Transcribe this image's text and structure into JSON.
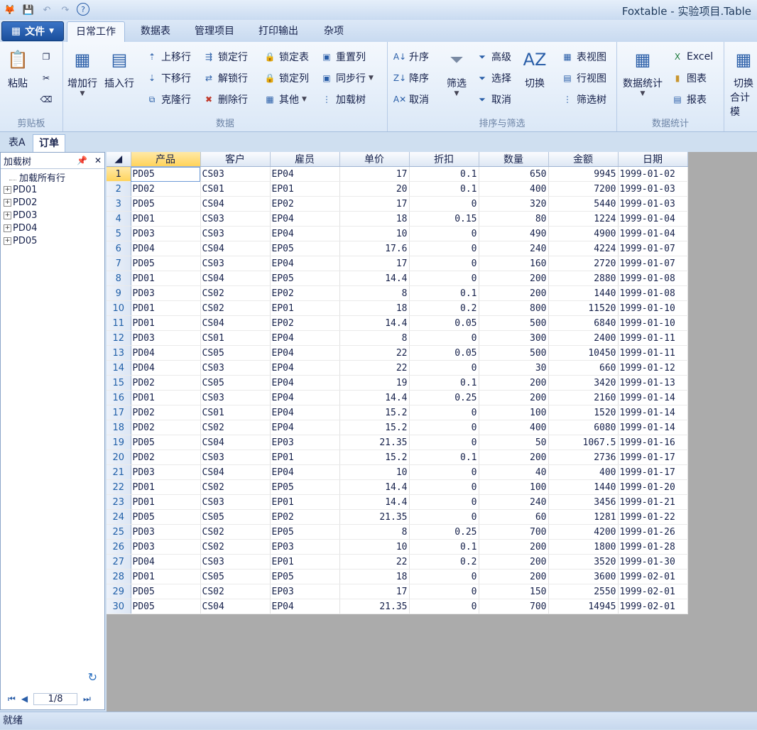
{
  "app": {
    "title": "Foxtable - 实验项目.Table"
  },
  "quick_access": [
    {
      "icon": "app-logo-icon"
    },
    {
      "icon": "save-icon"
    },
    {
      "icon": "undo-icon"
    },
    {
      "icon": "redo-icon"
    },
    {
      "icon": "help-icon"
    }
  ],
  "ribbon_tabs": {
    "file": "文件",
    "tab1": "日常工作",
    "tab2": "数据表",
    "tab3": "管理项目",
    "tab4": "打印输出",
    "tab5": "杂项"
  },
  "ribbon": {
    "clipboard": {
      "label": "剪贴板",
      "paste": "粘贴"
    },
    "data": {
      "label": "数据",
      "add_row": "增加行",
      "insert_row": "插入行",
      "move_up": "上移行",
      "move_down": "下移行",
      "clone_row": "克隆行",
      "lock_row": "锁定行",
      "unlock_row": "解锁行",
      "delete_row": "删除行",
      "lock_table": "锁定表",
      "lock_col": "锁定列",
      "other": "其他",
      "reset_col": "重置列",
      "sync_row": "同步行",
      "load_tree": "加载树"
    },
    "sort_filter": {
      "label": "排序与筛选",
      "asc": "升序",
      "desc": "降序",
      "cancel_sort": "取消",
      "filter": "筛选",
      "advanced": "高级",
      "select": "选择",
      "cancel_filter": "取消",
      "toggle": "切换",
      "table_view": "表视图",
      "row_view": "行视图",
      "filter_tree": "筛选树"
    },
    "stats": {
      "label": "数据统计",
      "data_stats": "数据统计",
      "excel": "Excel",
      "chart": "图表",
      "report": "报表",
      "toggle_total": "切换",
      "total_sub": "合计模"
    }
  },
  "doc_tabs": {
    "tab1": "表A",
    "tab2": "订单"
  },
  "left_panel": {
    "title": "加载树",
    "load_all": "加载所有行",
    "tree": [
      "PD01",
      "PD02",
      "PD03",
      "PD04",
      "PD05"
    ],
    "page": "1/8"
  },
  "grid": {
    "columns": [
      "产品",
      "客户",
      "雇员",
      "单价",
      "折扣",
      "数量",
      "金额",
      "日期"
    ],
    "rows": [
      [
        "1",
        "PD05",
        "CS03",
        "EP04",
        "17",
        "0.1",
        "650",
        "9945",
        "1999-01-02"
      ],
      [
        "2",
        "PD02",
        "CS01",
        "EP01",
        "20",
        "0.1",
        "400",
        "7200",
        "1999-01-03"
      ],
      [
        "3",
        "PD05",
        "CS04",
        "EP02",
        "17",
        "0",
        "320",
        "5440",
        "1999-01-03"
      ],
      [
        "4",
        "PD01",
        "CS03",
        "EP04",
        "18",
        "0.15",
        "80",
        "1224",
        "1999-01-04"
      ],
      [
        "5",
        "PD03",
        "CS03",
        "EP04",
        "10",
        "0",
        "490",
        "4900",
        "1999-01-04"
      ],
      [
        "6",
        "PD04",
        "CS04",
        "EP05",
        "17.6",
        "0",
        "240",
        "4224",
        "1999-01-07"
      ],
      [
        "7",
        "PD05",
        "CS03",
        "EP04",
        "17",
        "0",
        "160",
        "2720",
        "1999-01-07"
      ],
      [
        "8",
        "PD01",
        "CS04",
        "EP05",
        "14.4",
        "0",
        "200",
        "2880",
        "1999-01-08"
      ],
      [
        "9",
        "PD03",
        "CS02",
        "EP02",
        "8",
        "0.1",
        "200",
        "1440",
        "1999-01-08"
      ],
      [
        "10",
        "PD01",
        "CS02",
        "EP01",
        "18",
        "0.2",
        "800",
        "11520",
        "1999-01-10"
      ],
      [
        "11",
        "PD01",
        "CS04",
        "EP02",
        "14.4",
        "0.05",
        "500",
        "6840",
        "1999-01-10"
      ],
      [
        "12",
        "PD03",
        "CS01",
        "EP04",
        "8",
        "0",
        "300",
        "2400",
        "1999-01-11"
      ],
      [
        "13",
        "PD04",
        "CS05",
        "EP04",
        "22",
        "0.05",
        "500",
        "10450",
        "1999-01-11"
      ],
      [
        "14",
        "PD04",
        "CS03",
        "EP04",
        "22",
        "0",
        "30",
        "660",
        "1999-01-12"
      ],
      [
        "15",
        "PD02",
        "CS05",
        "EP04",
        "19",
        "0.1",
        "200",
        "3420",
        "1999-01-13"
      ],
      [
        "16",
        "PD01",
        "CS03",
        "EP04",
        "14.4",
        "0.25",
        "200",
        "2160",
        "1999-01-14"
      ],
      [
        "17",
        "PD02",
        "CS01",
        "EP04",
        "15.2",
        "0",
        "100",
        "1520",
        "1999-01-14"
      ],
      [
        "18",
        "PD02",
        "CS02",
        "EP04",
        "15.2",
        "0",
        "400",
        "6080",
        "1999-01-14"
      ],
      [
        "19",
        "PD05",
        "CS04",
        "EP03",
        "21.35",
        "0",
        "50",
        "1067.5",
        "1999-01-16"
      ],
      [
        "20",
        "PD02",
        "CS03",
        "EP01",
        "15.2",
        "0.1",
        "200",
        "2736",
        "1999-01-17"
      ],
      [
        "21",
        "PD03",
        "CS04",
        "EP04",
        "10",
        "0",
        "40",
        "400",
        "1999-01-17"
      ],
      [
        "22",
        "PD01",
        "CS02",
        "EP05",
        "14.4",
        "0",
        "100",
        "1440",
        "1999-01-20"
      ],
      [
        "23",
        "PD01",
        "CS03",
        "EP01",
        "14.4",
        "0",
        "240",
        "3456",
        "1999-01-21"
      ],
      [
        "24",
        "PD05",
        "CS05",
        "EP02",
        "21.35",
        "0",
        "60",
        "1281",
        "1999-01-22"
      ],
      [
        "25",
        "PD03",
        "CS02",
        "EP05",
        "8",
        "0.25",
        "700",
        "4200",
        "1999-01-26"
      ],
      [
        "26",
        "PD03",
        "CS02",
        "EP03",
        "10",
        "0.1",
        "200",
        "1800",
        "1999-01-28"
      ],
      [
        "27",
        "PD04",
        "CS03",
        "EP01",
        "22",
        "0.2",
        "200",
        "3520",
        "1999-01-30"
      ],
      [
        "28",
        "PD01",
        "CS05",
        "EP05",
        "18",
        "0",
        "200",
        "3600",
        "1999-02-01"
      ],
      [
        "29",
        "PD05",
        "CS02",
        "EP03",
        "17",
        "0",
        "150",
        "2550",
        "1999-02-01"
      ],
      [
        "30",
        "PD05",
        "CS04",
        "EP04",
        "21.35",
        "0",
        "700",
        "14945",
        "1999-02-01"
      ]
    ]
  },
  "status": {
    "text": "就绪"
  },
  "colors": {
    "accent": "#2a5ea8",
    "selected_header": "#ffd35a",
    "grid_background": "#ababab"
  }
}
